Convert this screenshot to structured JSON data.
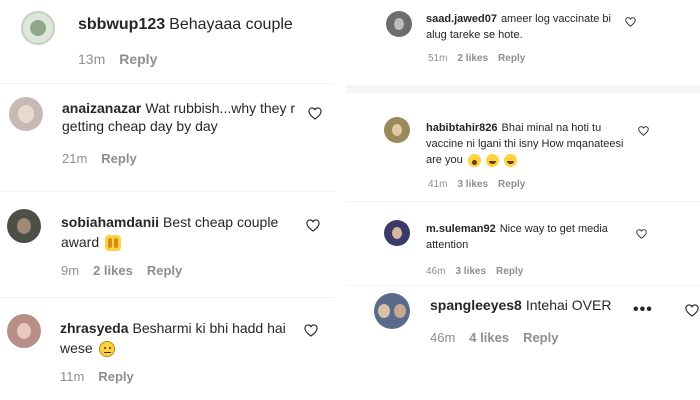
{
  "left_panel": {
    "comments": [
      {
        "username": "sbbwup123",
        "text": "Behayaaa couple",
        "time": "13m",
        "likes": "",
        "reply": "Reply",
        "avatar_color": "#8fa88a"
      },
      {
        "username": "anaizanazar",
        "text": "Wat rubbish...why they r getting cheap day by day",
        "time": "21m",
        "likes": "",
        "reply": "Reply",
        "avatar_color": "#c9b9b5"
      },
      {
        "username": "sobiahamdanii",
        "text": "Best cheap couple award",
        "time": "9m",
        "likes": "2 likes",
        "reply": "Reply",
        "avatar_color": "#4b4f45"
      },
      {
        "username": "zhrasyeda",
        "text": "Besharmi ki bhi hadd hai wese",
        "time": "11m",
        "likes": "",
        "reply": "Reply",
        "avatar_color": "#b78f86"
      }
    ]
  },
  "right_panel": {
    "comments": [
      {
        "username": "saad.jawed07",
        "text": "ameer log vaccinate bi alug tareke se hote.",
        "time": "51m",
        "likes": "2 likes",
        "reply": "Reply",
        "avatar_color": "#6d6d6d"
      },
      {
        "username": "habibtahir826",
        "text": "Bhai minal na hoti tu vaccine ni lgani thi isny How mqanateesi are you",
        "time": "41m",
        "likes": "3 likes",
        "reply": "Reply",
        "avatar_color": "#9a8a5a"
      },
      {
        "username": "m.suleman92",
        "text": "Nice way to get media attention",
        "time": "46m",
        "likes": "3 likes",
        "reply": "Reply",
        "avatar_color": "#3a3a6a"
      },
      {
        "username": "spangleeyes8",
        "text": "Intehai OVER",
        "time": "46m",
        "likes": "4 likes",
        "reply": "Reply",
        "avatar_color": "#5a6a8a"
      }
    ]
  },
  "colors": {
    "meta": "#8e8e8e",
    "text": "#262626",
    "emoji": "#ffd23e"
  },
  "icons": {
    "heart": "heart-icon",
    "more": "more-options-icon"
  }
}
